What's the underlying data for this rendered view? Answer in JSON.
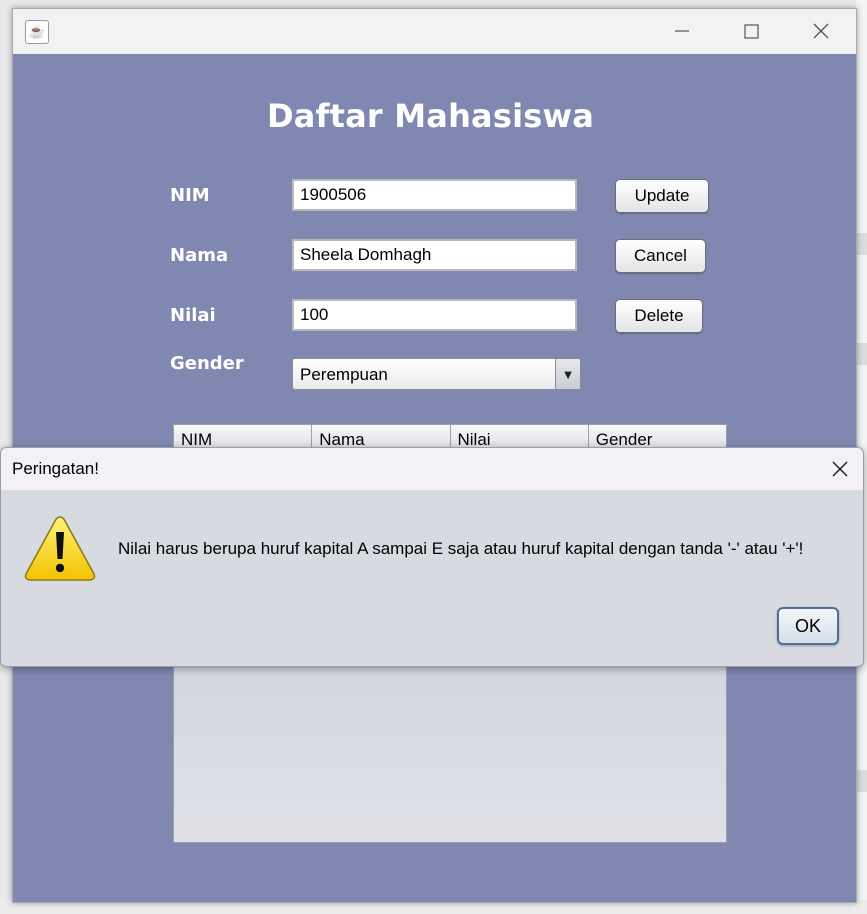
{
  "window": {
    "heading": "Daftar Mahasiswa"
  },
  "form": {
    "nim_label": "NIM",
    "nama_label": "Nama",
    "nilai_label": "Nilai",
    "gender_label": "Gender",
    "nim_value": "1900506",
    "nama_value": "Sheela Domhagh",
    "nilai_value": "100",
    "gender_value": "Perempuan"
  },
  "buttons": {
    "update": "Update",
    "cancel": "Cancel",
    "delete": "Delete"
  },
  "table": {
    "columns": [
      "NIM",
      "Nama",
      "Nilai",
      "Gender"
    ]
  },
  "dialog": {
    "title": "Peringatan!",
    "message": "Nilai harus berupa huruf kapital A sampai E saja atau huruf kapital dengan tanda '-' atau '+'!",
    "ok_label": "OK",
    "icon": "warning-icon"
  },
  "colors": {
    "window_bg": "#8088b1",
    "dialog_bg": "#d7dae1",
    "warning_yellow": "#f7d40c"
  }
}
